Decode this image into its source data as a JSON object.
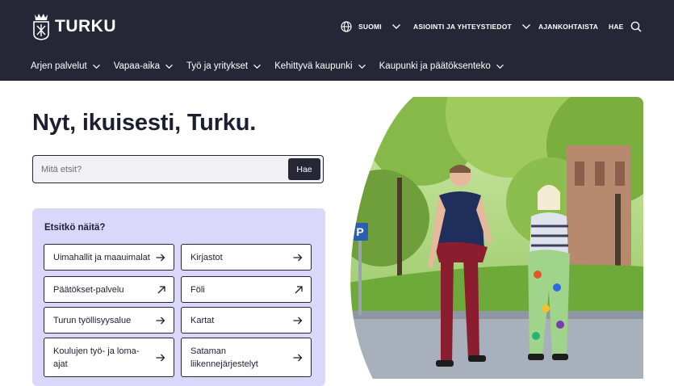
{
  "header": {
    "logo_text": "TURKU",
    "language": "SUOMI",
    "services_contact": "ASIOINTI JA YHTEYSTIEDOT",
    "current": "AJANKOHTAISTA",
    "search": "HAE"
  },
  "nav": {
    "items": [
      {
        "label": "Arjen palvelut"
      },
      {
        "label": "Vapaa-aika"
      },
      {
        "label": "Työ ja yritykset"
      },
      {
        "label": "Kehittyvä kaupunki"
      },
      {
        "label": "Kaupunki ja päätöksenteko"
      }
    ]
  },
  "main": {
    "title": "Nyt, ikuisesti, Turku.",
    "search_placeholder": "Mitä etsit?",
    "search_button": "Hae"
  },
  "suggestions": {
    "title": "Etsitkö näitä?",
    "items": [
      {
        "label": "Uimahallit ja maauimalat",
        "icon": "arrow-right-icon"
      },
      {
        "label": "Kirjastot",
        "icon": "arrow-right-icon"
      },
      {
        "label": "Päätökset-palvelu",
        "icon": "external-link-icon"
      },
      {
        "label": "Föli",
        "icon": "external-link-icon"
      },
      {
        "label": "Turun työllisyysalue",
        "icon": "arrow-right-icon"
      },
      {
        "label": "Kartat",
        "icon": "arrow-right-icon"
      },
      {
        "label": "Koulujen työ- ja loma-ajat",
        "icon": "arrow-right-icon"
      },
      {
        "label": "Sataman liikennejärjestelyt",
        "icon": "arrow-right-icon"
      }
    ]
  },
  "colors": {
    "header_bg": "#272637",
    "suggest_bg": "#d9d7fa",
    "text": "#1e1e32"
  }
}
